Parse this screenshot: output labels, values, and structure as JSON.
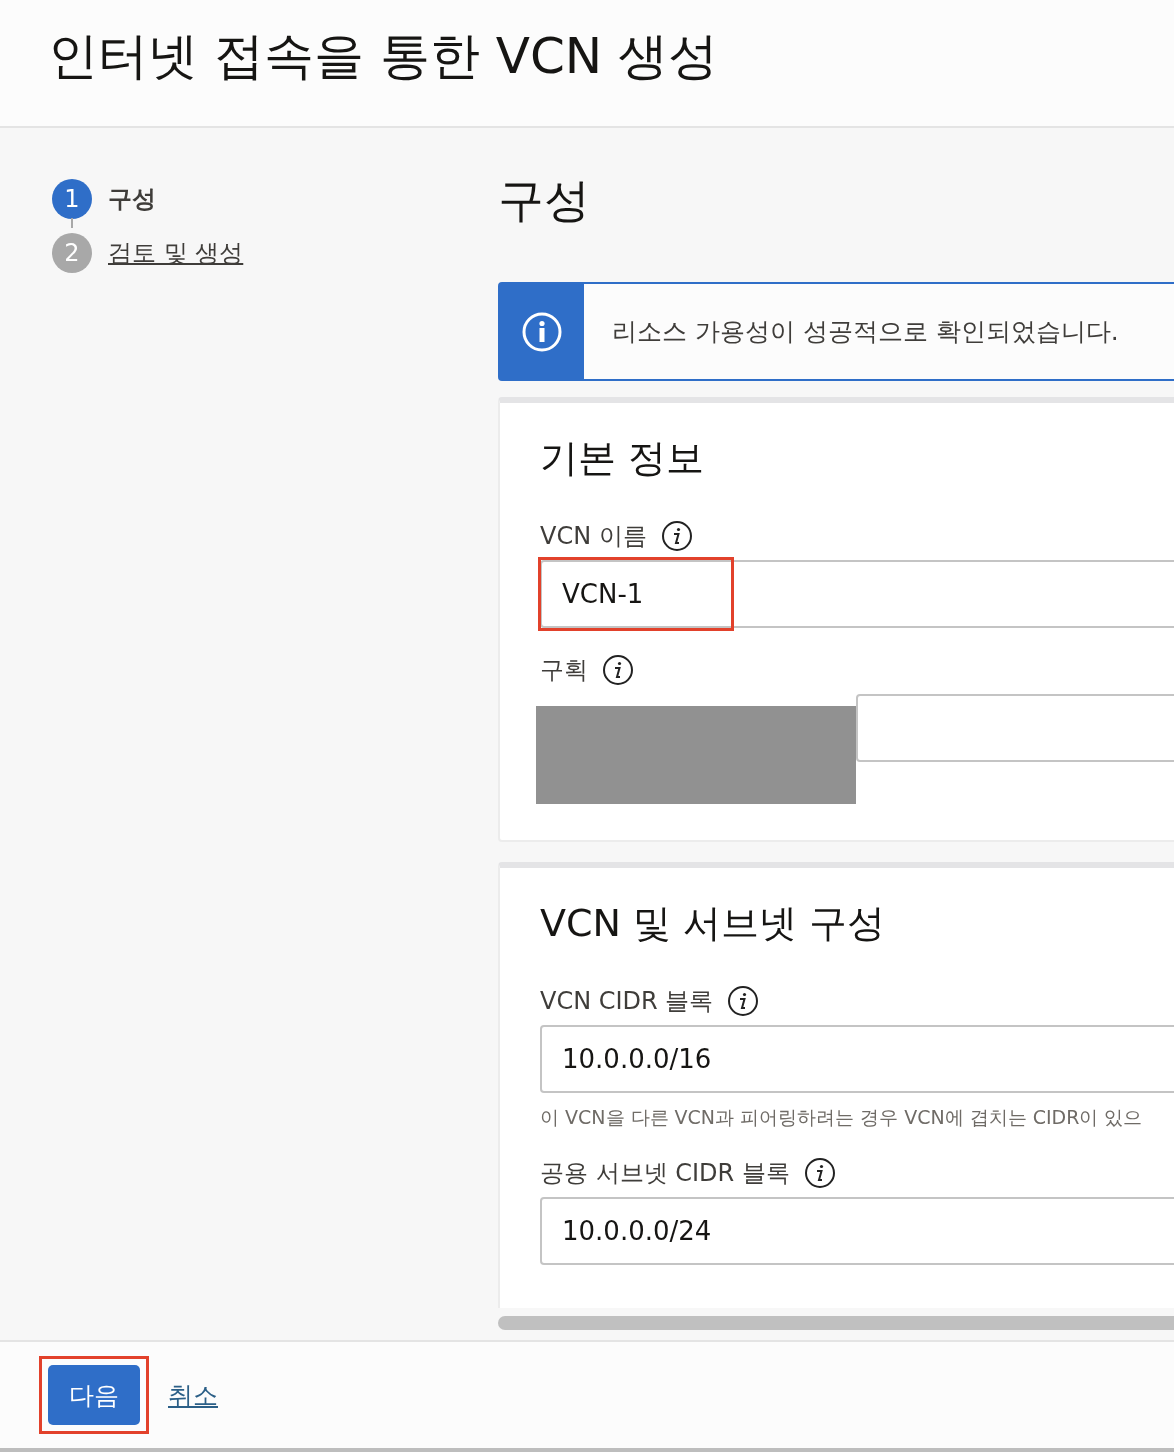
{
  "page": {
    "title": "인터넷 접속을 통한 VCN 생성"
  },
  "steps": [
    {
      "number": "1",
      "label": "구성",
      "selected": true
    },
    {
      "number": "2",
      "label": "검토 및 생성",
      "selected": false
    }
  ],
  "section_title": "구성",
  "banner": {
    "kind": "info",
    "message": "리소스 가용성이 성공적으로 확인되었습니다."
  },
  "cards": [
    {
      "title": "기본 정보",
      "fields": [
        {
          "label": "VCN 이름",
          "value": "VCN-1",
          "highlighted": true,
          "redacted": false
        },
        {
          "label": "구획",
          "redacted": true,
          "highlighted": false
        }
      ]
    },
    {
      "title": "VCN 및 서브넷 구성",
      "fields": [
        {
          "label": "VCN CIDR 블록",
          "value": "10.0.0.0/16",
          "help": "이 VCN을 다른 VCN과 피어링하려는 경우 VCN에 겹치는 CIDR이 있으",
          "highlighted": false,
          "redacted": false
        },
        {
          "label": "공용 서브넷 CIDR 블록",
          "value": "10.0.0.0/24",
          "highlighted": false,
          "redacted": false
        }
      ]
    }
  ],
  "footer": {
    "primary": {
      "label": "다음",
      "highlighted": true
    },
    "cancel": {
      "label": "취소"
    }
  }
}
